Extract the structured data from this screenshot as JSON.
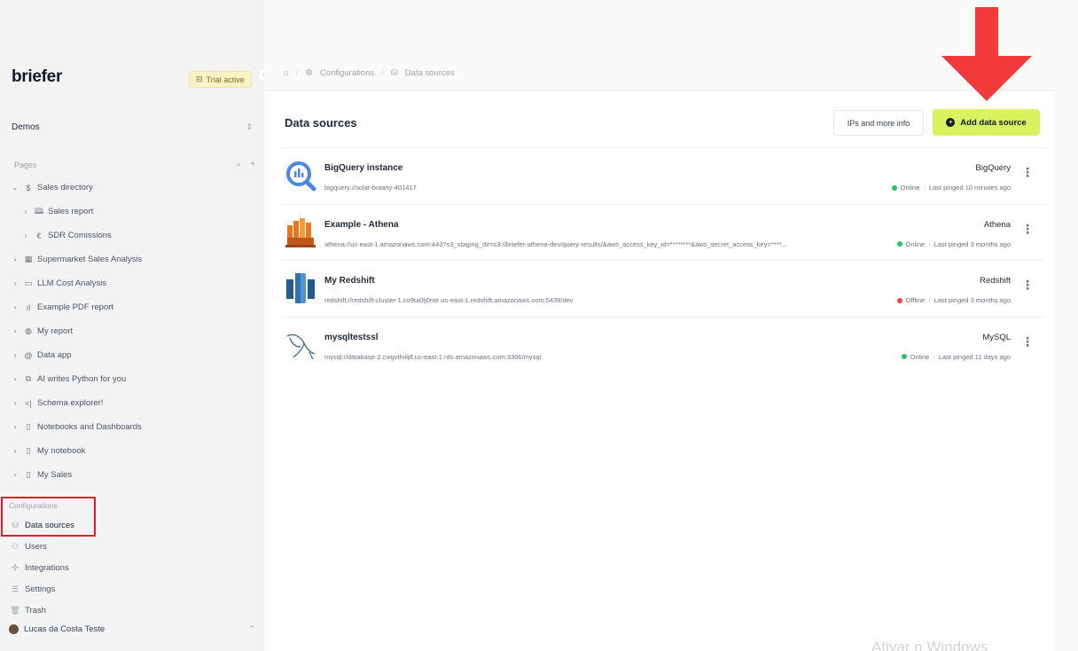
{
  "app": {
    "name": "briefer",
    "trial_badge": "Trial active"
  },
  "workspace": {
    "name": "Demos"
  },
  "pages_label": "Pages",
  "pages": [
    {
      "label": "Sales directory",
      "icon": "dollar-icon",
      "glyph": "$",
      "level": 0,
      "caret": "⌄"
    },
    {
      "label": "Sales report",
      "icon": "book-icon",
      "glyph": "🕮",
      "level": 1,
      "caret": "›"
    },
    {
      "label": "SDR Comissions",
      "icon": "euro-icon",
      "glyph": "€",
      "level": 1,
      "caret": "›"
    },
    {
      "label": "Supermarket Sales Analysis",
      "icon": "store-icon",
      "glyph": "▦",
      "level": 0,
      "caret": "›"
    },
    {
      "label": "LLM Cost Analysis",
      "icon": "monitor-icon",
      "glyph": "▭",
      "level": 0,
      "caret": "›"
    },
    {
      "label": "Example PDF report",
      "icon": "bar-chart-icon",
      "glyph": "ıl",
      "level": 0,
      "caret": "›"
    },
    {
      "label": "My report",
      "icon": "globe-icon",
      "glyph": "◍",
      "level": 0,
      "caret": "›"
    },
    {
      "label": "Data app",
      "icon": "at-icon",
      "glyph": "@",
      "level": 0,
      "caret": "›"
    },
    {
      "label": "AI writes Python for you",
      "icon": "files-icon",
      "glyph": "⧉",
      "level": 0,
      "caret": "›"
    },
    {
      "label": "Schema explorer!",
      "icon": "code-icon",
      "glyph": "<|",
      "level": 0,
      "caret": "›"
    },
    {
      "label": "Notebooks and Dashboards",
      "icon": "file-icon",
      "glyph": "▯",
      "level": 0,
      "caret": "›"
    },
    {
      "label": "My notebook",
      "icon": "file-icon",
      "glyph": "▯",
      "level": 0,
      "caret": "›"
    },
    {
      "label": "My Sales",
      "icon": "file-icon",
      "glyph": "▯",
      "level": 0,
      "caret": "›"
    }
  ],
  "configurations_label": "Configurations",
  "config_nav": [
    {
      "label": "Data sources",
      "icon": "database-icon",
      "glyph": "⛁",
      "active": true
    },
    {
      "label": "Users",
      "icon": "users-icon",
      "glyph": "⚇",
      "active": false
    },
    {
      "label": "Integrations",
      "icon": "puzzle-icon",
      "glyph": "✣",
      "active": false
    },
    {
      "label": "Settings",
      "icon": "sliders-icon",
      "glyph": "☰",
      "active": false
    },
    {
      "label": "Trash",
      "icon": "trash-icon",
      "glyph": "🗑",
      "active": false
    }
  ],
  "user": {
    "name": "Lucas da Costa Teste"
  },
  "breadcrumb": {
    "home_icon": "home-icon",
    "items": [
      "Configurations",
      "Data sources"
    ]
  },
  "main": {
    "title": "Data sources",
    "ips_button": "IPs and more info",
    "add_button": "Add data source"
  },
  "data_sources": [
    {
      "name": "BigQuery instance",
      "connection": "bigquery://solar-botany-401417",
      "type": "BigQuery",
      "status": "Online",
      "status_color": "#22c55e",
      "pinged": "Last pinged 10 minutes ago",
      "logo": "bigquery-logo"
    },
    {
      "name": "Example - Athena",
      "connection": "athena://us-east-1.amazonaws.com:443?s3_staging_dir=s3://briefer-athena-dev/query-results/&aws_access_key_id=********&aws_secret_access_key=****...",
      "type": "Athena",
      "status": "Online",
      "status_color": "#22c55e",
      "pinged": "Last pinged 3 months ago",
      "logo": "athena-logo"
    },
    {
      "name": "My Redshift",
      "connection": "redshift://redshift-cluster-1.co9ta0lj0nte.us-east-1.redshift.amazonaws.com:5439/dev",
      "type": "Redshift",
      "status": "Offline",
      "status_color": "#ef4444",
      "pinged": "Last pinged 3 months ago",
      "logo": "redshift-logo"
    },
    {
      "name": "mysqltestssl",
      "connection": "mysql://database-2.cwgvthiiljtf.us-east-1.rds.amazonaws.com:3306/mysql",
      "type": "MySQL",
      "status": "Online",
      "status_color": "#22c55e",
      "pinged": "Last pinged 11 days ago",
      "logo": "mysql-logo"
    }
  ],
  "watermark": "Ativar o Windows",
  "colors": {
    "accent": "#d9f25d",
    "annotation_red": "#e11d2a",
    "arrow_red": "#f23a3a"
  }
}
